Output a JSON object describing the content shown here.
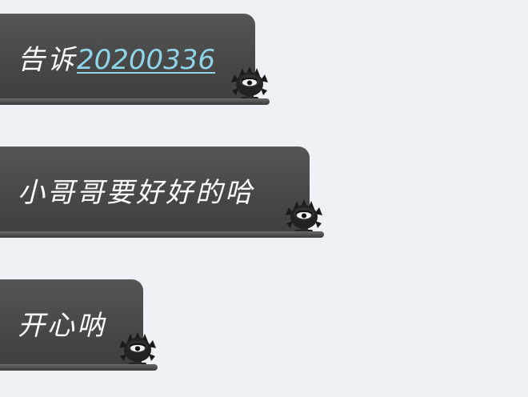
{
  "messages": [
    {
      "prefix": "告诉",
      "mention": "20200336"
    },
    {
      "text": "小哥哥要好好的哈"
    },
    {
      "text": "开心呐"
    }
  ],
  "sticker_icon": "black-spiky-creature-icon",
  "colors": {
    "background": "#eef1f6",
    "bubble": "#4a4a4a",
    "text": "#ffffff",
    "mention": "#8fd4e8"
  }
}
